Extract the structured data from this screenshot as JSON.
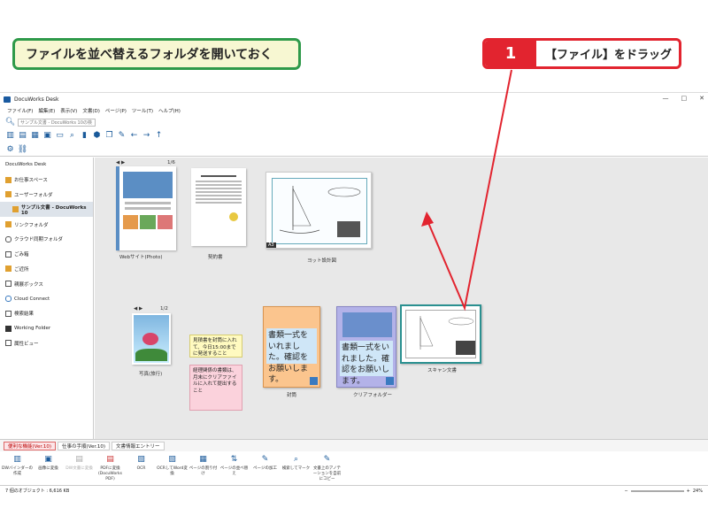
{
  "callouts": {
    "green_text": "ファイルを並べ替えるフォルダを開いておく",
    "red_number": "1",
    "red_text": "【ファイル】をドラッグ"
  },
  "window": {
    "title": "DocuWorks Desk",
    "controls": [
      "—",
      "□",
      "✕"
    ]
  },
  "menu": [
    "ファイル(F)",
    "編集(E)",
    "表示(V)",
    "文書(D)",
    "ページ(P)",
    "ツール(T)",
    "ヘルプ(H)"
  ],
  "search": {
    "placeholder": "サンプル文書 - DocuWorks 10の検"
  },
  "sidebar": {
    "header": "DocuWorks Desk",
    "items": [
      {
        "label": "お仕事スペース"
      },
      {
        "label": "ユーザーフォルダ"
      },
      {
        "label": "サンプル文書 - DocuWorks 10"
      },
      {
        "label": "リンクフォルダ"
      },
      {
        "label": "クラウド同期フォルダ"
      },
      {
        "label": "ごみ箱"
      },
      {
        "label": "ご近所"
      },
      {
        "label": "親展ボックス"
      },
      {
        "label": "Cloud Connect"
      },
      {
        "label": "検索結果"
      },
      {
        "label": "Working Folder"
      },
      {
        "label": "属性ビュー"
      }
    ]
  },
  "desk": {
    "docs": [
      {
        "label": "Webサイト(Photo)",
        "pages": "1/6"
      },
      {
        "label": "契約書"
      },
      {
        "label": "ヨット設計図",
        "badge": "A3"
      },
      {
        "label": "写真(旅行)",
        "pages": "1/2"
      },
      {
        "label": "封筒",
        "text": "書類一式をいれました。確認をお願いします。"
      },
      {
        "label": "クリアフォルダー",
        "text": "書類一式をいれました。確認をお願いします。"
      },
      {
        "label": "スキャン文書"
      }
    ],
    "stickies": [
      {
        "text": "見積書を封筒に入れて、今日15:00までに発送すること"
      },
      {
        "text": "経理関係の書類は、月末にクリアファイルに入れて提出すること"
      }
    ]
  },
  "tabs": [
    "便利な機能(Ver.10)",
    "仕事の手順(Ver.10)",
    "文書情報エントリー"
  ],
  "bottom_tools": [
    "DWバインダーの作成",
    "画像に変換",
    "DW文書に変換",
    "PDFに変換(DocuWorks PDF)",
    "OCR",
    "OCRしてWord変換",
    "ページの割り付け",
    "ページの並べ替え",
    "ページの加工",
    "検索してマーク",
    "文書上のアノテーションを自前にコピー"
  ],
  "status": {
    "text": "7 個のオブジェクト : 6,616 KB",
    "zoom": "24%"
  }
}
